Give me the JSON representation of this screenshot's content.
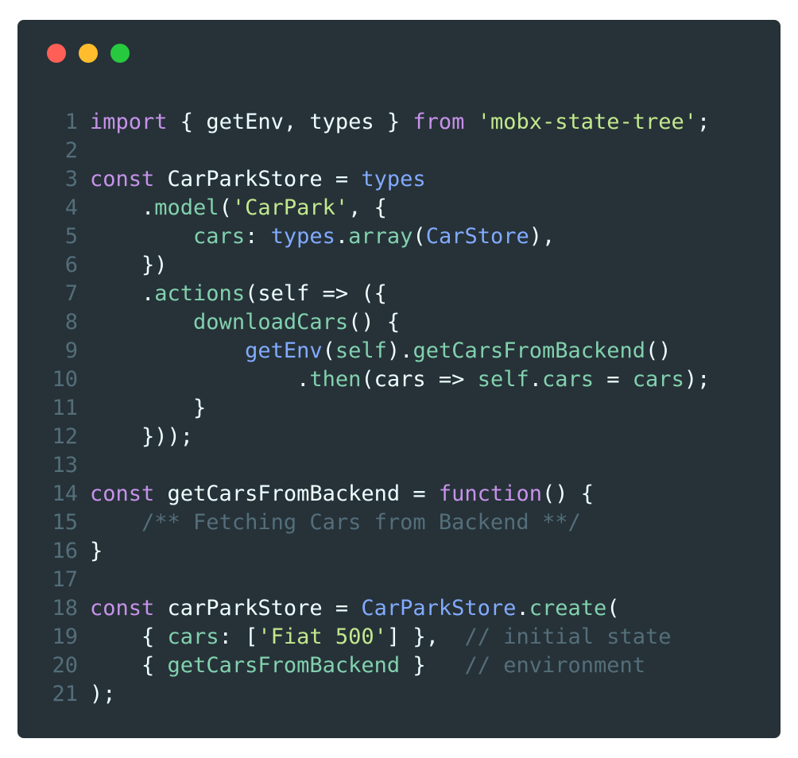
{
  "window": {
    "traffic_lights": [
      {
        "name": "close",
        "color": "#ff5f56"
      },
      {
        "name": "minimize",
        "color": "#ffbd2e"
      },
      {
        "name": "maximize",
        "color": "#27c93f"
      }
    ]
  },
  "theme": {
    "background": "#263238",
    "keyword": "#c792ea",
    "string": "#c3e88d",
    "function": "#82aaff",
    "method": "#82d1ae",
    "plain": "#eeffff",
    "comment": "#546e7a",
    "line_number": "#546e7a"
  },
  "code": {
    "lines": [
      {
        "n": "1",
        "tokens": [
          {
            "t": "import",
            "c": "k"
          },
          {
            "t": " { getEnv, types } ",
            "c": "p"
          },
          {
            "t": "from",
            "c": "k"
          },
          {
            "t": " ",
            "c": "p"
          },
          {
            "t": "'mobx-state-tree'",
            "c": "s"
          },
          {
            "t": ";",
            "c": "p"
          }
        ]
      },
      {
        "n": "2",
        "tokens": []
      },
      {
        "n": "3",
        "tokens": [
          {
            "t": "const",
            "c": "k"
          },
          {
            "t": " CarParkStore = ",
            "c": "p"
          },
          {
            "t": "types",
            "c": "f"
          }
        ]
      },
      {
        "n": "4",
        "tokens": [
          {
            "t": "    .",
            "c": "p"
          },
          {
            "t": "model",
            "c": "m"
          },
          {
            "t": "(",
            "c": "p"
          },
          {
            "t": "'CarPark'",
            "c": "s"
          },
          {
            "t": ", {",
            "c": "p"
          }
        ]
      },
      {
        "n": "5",
        "tokens": [
          {
            "t": "        ",
            "c": "p"
          },
          {
            "t": "cars",
            "c": "m"
          },
          {
            "t": ": ",
            "c": "p"
          },
          {
            "t": "types",
            "c": "f"
          },
          {
            "t": ".",
            "c": "p"
          },
          {
            "t": "array",
            "c": "m"
          },
          {
            "t": "(",
            "c": "p"
          },
          {
            "t": "CarStore",
            "c": "f"
          },
          {
            "t": "),",
            "c": "p"
          }
        ]
      },
      {
        "n": "6",
        "tokens": [
          {
            "t": "    })",
            "c": "p"
          }
        ]
      },
      {
        "n": "7",
        "tokens": [
          {
            "t": "    .",
            "c": "p"
          },
          {
            "t": "actions",
            "c": "m"
          },
          {
            "t": "(self => ({",
            "c": "p"
          }
        ]
      },
      {
        "n": "8",
        "tokens": [
          {
            "t": "        ",
            "c": "p"
          },
          {
            "t": "downloadCars",
            "c": "m"
          },
          {
            "t": "() {",
            "c": "p"
          }
        ]
      },
      {
        "n": "9",
        "tokens": [
          {
            "t": "            ",
            "c": "p"
          },
          {
            "t": "getEnv",
            "c": "f"
          },
          {
            "t": "(",
            "c": "p"
          },
          {
            "t": "self",
            "c": "m"
          },
          {
            "t": ").",
            "c": "p"
          },
          {
            "t": "getCarsFromBackend",
            "c": "m"
          },
          {
            "t": "()",
            "c": "p"
          }
        ]
      },
      {
        "n": "10",
        "tokens": [
          {
            "t": "                .",
            "c": "p"
          },
          {
            "t": "then",
            "c": "m"
          },
          {
            "t": "(cars => ",
            "c": "p"
          },
          {
            "t": "self",
            "c": "m"
          },
          {
            "t": ".",
            "c": "p"
          },
          {
            "t": "cars",
            "c": "m"
          },
          {
            "t": " = ",
            "c": "p"
          },
          {
            "t": "cars",
            "c": "m"
          },
          {
            "t": ");",
            "c": "p"
          }
        ]
      },
      {
        "n": "11",
        "tokens": [
          {
            "t": "        }",
            "c": "p"
          }
        ]
      },
      {
        "n": "12",
        "tokens": [
          {
            "t": "    }));",
            "c": "p"
          }
        ]
      },
      {
        "n": "13",
        "tokens": []
      },
      {
        "n": "14",
        "tokens": [
          {
            "t": "const",
            "c": "k"
          },
          {
            "t": " getCarsFromBackend = ",
            "c": "p"
          },
          {
            "t": "function",
            "c": "k"
          },
          {
            "t": "() {",
            "c": "p"
          }
        ]
      },
      {
        "n": "15",
        "tokens": [
          {
            "t": "    ",
            "c": "p"
          },
          {
            "t": "/** Fetching Cars from Backend **/",
            "c": "c"
          }
        ]
      },
      {
        "n": "16",
        "tokens": [
          {
            "t": "}",
            "c": "p"
          }
        ]
      },
      {
        "n": "17",
        "tokens": []
      },
      {
        "n": "18",
        "tokens": [
          {
            "t": "const",
            "c": "k"
          },
          {
            "t": " carParkStore = ",
            "c": "p"
          },
          {
            "t": "CarParkStore",
            "c": "f"
          },
          {
            "t": ".",
            "c": "p"
          },
          {
            "t": "create",
            "c": "m"
          },
          {
            "t": "(",
            "c": "p"
          }
        ]
      },
      {
        "n": "19",
        "tokens": [
          {
            "t": "    { ",
            "c": "p"
          },
          {
            "t": "cars",
            "c": "m"
          },
          {
            "t": ": [",
            "c": "p"
          },
          {
            "t": "'Fiat 500'",
            "c": "s"
          },
          {
            "t": "] },  ",
            "c": "p"
          },
          {
            "t": "// initial state",
            "c": "c"
          }
        ]
      },
      {
        "n": "20",
        "tokens": [
          {
            "t": "    { ",
            "c": "p"
          },
          {
            "t": "getCarsFromBackend",
            "c": "m"
          },
          {
            "t": " }   ",
            "c": "p"
          },
          {
            "t": "// environment",
            "c": "c"
          }
        ]
      },
      {
        "n": "21",
        "tokens": [
          {
            "t": ");",
            "c": "p"
          }
        ]
      }
    ]
  }
}
